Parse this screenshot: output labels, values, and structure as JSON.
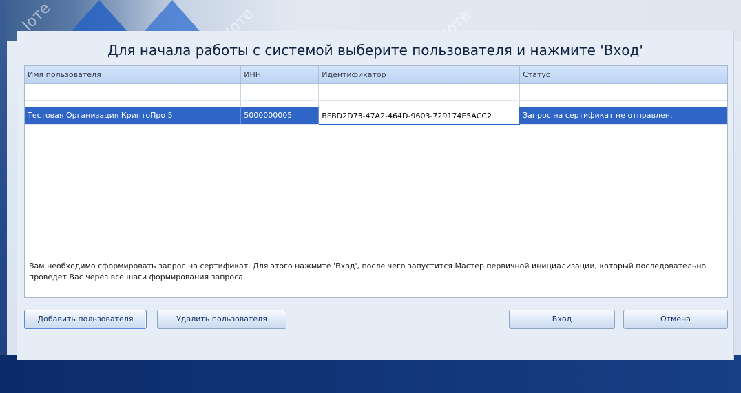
{
  "window": {
    "title": "Для начала работы с системой выберите пользователя и нажмите 'Вход'"
  },
  "table": {
    "columns": [
      "Имя пользователя",
      "ИНН",
      "Идентификатор",
      "Статус"
    ],
    "rows": [
      {
        "name": "Тестовая Организация КриптоПро 5",
        "inn": "5000000005",
        "id": "BFBD2D73-47A2-464D-9603-729174E5ACC2",
        "status": "Запрос на сертификат не отправлен."
      }
    ]
  },
  "info_text": "Вам необходимо сформировать запрос на сертификат. Для этого нажмите 'Вход', после чего запустится Мастер первичной инициализации, который последовательно проведет Вас через все шаги формирования запроса.",
  "buttons": {
    "add_user": "Добавить пользователя",
    "delete_user": "Удалить пользователя",
    "login": "Вход",
    "cancel": "Отмена"
  },
  "watermark": {
    "text_1": "Ioте",
    "text_2": "Iоте",
    "text_3": "Iоте"
  },
  "colors": {
    "accent": "#2f65c7",
    "header_gradient_top": "#d4e4fa",
    "background_dark": "#123579"
  }
}
